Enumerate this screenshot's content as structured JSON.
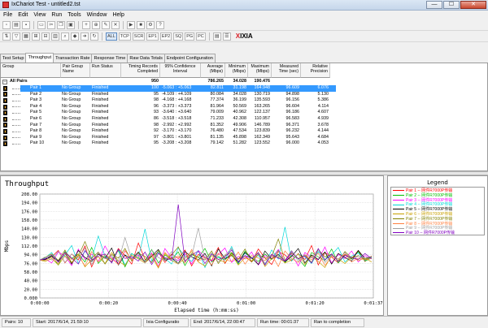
{
  "window": {
    "title": "IxChariot Test - untitled2.tst",
    "minimize": "—",
    "maximize": "☐",
    "close": "✕"
  },
  "menu": [
    "File",
    "Edit",
    "View",
    "Run",
    "Tools",
    "Window",
    "Help"
  ],
  "toolbar2_labels": [
    "ALL",
    "TCP",
    "SCR",
    "EP1",
    "EP2",
    "SQ",
    "PG",
    "PC"
  ],
  "brand": {
    "x": "X",
    "rest": "IXIA"
  },
  "tabs": [
    "Test Setup",
    "Throughput",
    "Transaction Rate",
    "Response Time",
    "Raw Data Totals",
    "Endpoint Configuration"
  ],
  "grid": {
    "headers": {
      "group": "Group",
      "pair_group": "Pair Group Name",
      "run_status": "Run Status",
      "records": "Timing Records Completed",
      "confidence": "95% Confidence Interval",
      "average": "Average (Mbps)",
      "minimum": "Minimum (Mbps)",
      "maximum": "Maximum (Mbps)",
      "time": "Measured Time (sec)",
      "precision": "Relative Precision"
    },
    "summary": {
      "label": "All Pairs",
      "records": "950",
      "average": "786.265",
      "minimum": "34.028",
      "maximum": "190.476",
      "toggle": "−"
    },
    "rows": [
      {
        "name": "Pair 1",
        "group": "No Group",
        "status": "Finished",
        "records": "100",
        "confidence": "-5.063 : +5.063",
        "average": "82.811",
        "minimum": "31.198",
        "maximum": "164.948",
        "time": "96.609",
        "precision": "6.076"
      },
      {
        "name": "Pair 2",
        "group": "No Group",
        "status": "Finished",
        "records": "95",
        "confidence": "-4.109 : +4.109",
        "average": "80.084",
        "minimum": "34.028",
        "maximum": "130.719",
        "time": "94.898",
        "precision": "5.130"
      },
      {
        "name": "Pair 3",
        "group": "No Group",
        "status": "Finished",
        "records": "98",
        "confidence": "-4.168 : +4.168",
        "average": "77.374",
        "minimum": "36.199",
        "maximum": "135.593",
        "time": "96.156",
        "precision": "5.386"
      },
      {
        "name": "Pair 4",
        "group": "No Group",
        "status": "Finished",
        "records": "96",
        "confidence": "-3.373 : +3.373",
        "average": "81.964",
        "minimum": "50.569",
        "maximum": "163.265",
        "time": "96.604",
        "precision": "4.114"
      },
      {
        "name": "Pair 5",
        "group": "No Group",
        "status": "Finished",
        "records": "93",
        "confidence": "-3.640 : +3.640",
        "average": "79.009",
        "minimum": "40.962",
        "maximum": "122.137",
        "time": "96.186",
        "precision": "4.607"
      },
      {
        "name": "Pair 6",
        "group": "No Group",
        "status": "Finished",
        "records": "86",
        "confidence": "-3.518 : +3.518",
        "average": "71.233",
        "minimum": "42.308",
        "maximum": "110.957",
        "time": "96.583",
        "precision": "4.939"
      },
      {
        "name": "Pair 7",
        "group": "No Group",
        "status": "Finished",
        "records": "98",
        "confidence": "-2.992 : +2.992",
        "average": "81.352",
        "minimum": "49.906",
        "maximum": "146.789",
        "time": "96.371",
        "precision": "3.678"
      },
      {
        "name": "Pair 8",
        "group": "No Group",
        "status": "Finished",
        "records": "92",
        "confidence": "-3.170 : +3.170",
        "average": "76.480",
        "minimum": "47.534",
        "maximum": "123.839",
        "time": "96.232",
        "precision": "4.144"
      },
      {
        "name": "Pair 9",
        "group": "No Group",
        "status": "Finished",
        "records": "97",
        "confidence": "-3.801 : +3.801",
        "average": "81.135",
        "minimum": "45.898",
        "maximum": "162.349",
        "time": "95.643",
        "precision": "4.684"
      },
      {
        "name": "Pair 10",
        "group": "No Group",
        "status": "Finished",
        "records": "95",
        "confidence": "-3.208 : +3.208",
        "average": "79.142",
        "minimum": "51.282",
        "maximum": "123.552",
        "time": "96.000",
        "precision": "4.053"
      }
    ]
  },
  "legend": {
    "title": "Legend",
    "items": [
      {
        "label": "Pair 1 -- 网件R7000P传输",
        "color": "#ff0000"
      },
      {
        "label": "Pair 2 -- 网件R7000P传输",
        "color": "#00c000"
      },
      {
        "label": "Pair 3 -- 网件R7000P传输",
        "color": "#ff00ff"
      },
      {
        "label": "Pair 4 -- 网件R7000P传输",
        "color": "#00d8d8"
      },
      {
        "label": "Pair 5 -- 网件R7000P传输",
        "color": "#000000"
      },
      {
        "label": "Pair 6 -- 网件R7000P传输",
        "color": "#c8a000"
      },
      {
        "label": "Pair 7 -- 网件R7000P传输",
        "color": "#808000"
      },
      {
        "label": "Pair 8 -- 网件R7000P传输",
        "color": "#ff8040"
      },
      {
        "label": "Pair 9 -- 网件R7000P传输",
        "color": "#a0a0a0"
      },
      {
        "label": "Pair 10 -- 网件R7000P传输",
        "color": "#8000c0"
      }
    ]
  },
  "chart_data": {
    "type": "line",
    "title": "Throughput",
    "xlabel": "Elapsed time (h:mm:ss)",
    "ylabel": "Mbps",
    "ylim": [
      0,
      208
    ],
    "yticks": [
      "208.00",
      "194.00",
      "176.00",
      "158.00",
      "140.00",
      "130.00",
      "112.00",
      "94.00",
      "76.00",
      "58.00",
      "40.00",
      "20.00",
      "0.000"
    ],
    "xticks": [
      "0:00:00",
      "0:00:20",
      "0:00:40",
      "0:01:00",
      "0:01:20",
      "0:01:37"
    ],
    "xlim_sec": [
      0,
      97
    ],
    "grid": true,
    "series": [
      {
        "name": "Pair 1 -- 网件R7000P传输",
        "color": "#ff0000",
        "values": [
          78,
          82,
          95,
          70,
          88,
          76,
          104,
          62,
          91,
          80,
          73,
          99,
          85,
          68,
          110,
          77,
          83,
          92,
          71,
          88,
          79,
          96,
          64,
          87,
          81,
          75,
          101,
          69,
          90,
          78,
          84,
          72,
          98,
          80,
          67,
          93,
          86,
          74,
          89,
          77,
          105,
          66,
          91,
          82,
          70,
          88,
          79,
          95,
          73,
          84
        ]
      },
      {
        "name": "Pair 2 -- 网件R7000P传输",
        "color": "#00c000",
        "values": [
          76,
          85,
          66,
          93,
          79,
          88,
          72,
          101,
          69,
          84,
          77,
          95,
          62,
          89,
          80,
          74,
          97,
          70,
          86,
          78,
          92,
          65,
          87,
          81,
          99,
          72,
          83,
          76,
          90,
          68,
          94,
          80,
          73,
          88,
          77,
          96,
          71,
          85,
          79,
          63,
          91,
          82,
          75,
          98,
          70,
          86,
          78,
          93,
          74,
          80
        ]
      },
      {
        "name": "Pair 3 -- 网件R7000P传输",
        "color": "#ff00ff",
        "values": [
          79,
          70,
          92,
          84,
          65,
          98,
          77,
          88,
          73,
          104,
          81,
          69,
          94,
          78,
          86,
          72,
          90,
          63,
          99,
          80,
          75,
          89,
          68,
          95,
          82,
          74,
          87,
          100,
          71,
          83,
          78,
          92,
          66,
          85,
          79,
          97,
          73,
          88,
          64,
          91,
          81,
          76,
          102,
          70,
          87,
          79,
          94,
          72,
          85,
          78
        ]
      },
      {
        "name": "Pair 4 -- 网件R7000P传输",
        "color": "#00d8d8",
        "values": [
          80,
          91,
          72,
          86,
          105,
          69,
          94,
          78,
          124,
          83,
          71,
          97,
          66,
          89,
          80,
          138,
          74,
          92,
          79,
          68,
          100,
          84,
          73,
          95,
          61,
          88,
          81,
          76,
          103,
          70,
          90,
          79,
          85,
          67,
          96,
          78,
          142,
          74,
          88,
          82,
          69,
          93,
          77,
          86,
          101,
          72,
          84,
          90,
          75,
          81
        ]
      },
      {
        "name": "Pair 5 -- 网件R7000P传输",
        "color": "#000000",
        "values": [
          77,
          83,
          74,
          90,
          68,
          95,
          81,
          73,
          88,
          79,
          100,
          66,
          86,
          78,
          92,
          71,
          84,
          97,
          75,
          80,
          69,
          93,
          82,
          76,
          89,
          64,
          98,
          79,
          85,
          72,
          91,
          80,
          67,
          94,
          78,
          87,
          73,
          83,
          99,
          70,
          86,
          77,
          92,
          68,
          89,
          81,
          74,
          95,
          79,
          83
        ]
      },
      {
        "name": "Pair 6 -- 网件R7000P传输",
        "color": "#c8a000",
        "values": [
          73,
          79,
          66,
          84,
          71,
          88,
          62,
          77,
          82,
          69,
          91,
          74,
          65,
          86,
          78,
          70,
          83,
          60,
          89,
          75,
          68,
          80,
          93,
          72,
          64,
          85,
          77,
          71,
          87,
          66,
          81,
          74,
          90,
          63,
          79,
          83,
          70,
          76,
          88,
          67,
          84,
          73,
          61,
          86,
          78,
          69,
          82,
          75,
          80,
          72
        ]
      },
      {
        "name": "Pair 7 -- 网件R7000P传输",
        "color": "#808000",
        "values": [
          81,
          88,
          75,
          96,
          70,
          84,
          113,
          79,
          92,
          68,
          87,
          80,
          99,
          74,
          90,
          83,
          71,
          95,
          78,
          86,
          102,
          73,
          89,
          81,
          76,
          94,
          69,
          85,
          91,
          77,
          98,
          72,
          87,
          80,
          83,
          118,
          75,
          90,
          79,
          86,
          71,
          97,
          82,
          88,
          74,
          93,
          80,
          85,
          77,
          82
        ]
      },
      {
        "name": "Pair 8 -- 网件R7000P传输",
        "color": "#ff8040",
        "values": [
          75,
          82,
          69,
          90,
          77,
          85,
          64,
          93,
          72,
          87,
          79,
          67,
          95,
          76,
          83,
          71,
          88,
          62,
          91,
          78,
          84,
          70,
          97,
          74,
          81,
          66,
          89,
          77,
          73,
          92,
          68,
          85,
          80,
          75,
          87,
          63,
          94,
          79,
          71,
          86,
          76,
          90,
          65,
          83,
          78,
          88,
          72,
          80,
          76,
          79
        ]
      },
      {
        "name": "Pair 9 -- 网件R7000P传输",
        "color": "#a0a0a0",
        "values": [
          82,
          76,
          94,
          71,
          88,
          80,
          100,
          67,
          91,
          79,
          85,
          73,
          121,
          78,
          89,
          70,
          96,
          81,
          75,
          93,
          68,
          87,
          83,
          140,
          77,
          90,
          72,
          86,
          99,
          74,
          84,
          79,
          92,
          69,
          88,
          81,
          76,
          95,
          73,
          87,
          80,
          98,
          71,
          85,
          78,
          91,
          75,
          84,
          80,
          83
        ]
      },
      {
        "name": "Pair 10 -- 网件R7000P传输",
        "color": "#8000c0",
        "values": [
          78,
          86,
          72,
          91,
          80,
          68,
          95,
          76,
          84,
          88,
          70,
          97,
          79,
          83,
          74,
          92,
          67,
          89,
          81,
          75,
          187,
          73,
          86,
          94,
          69,
          88,
          77,
          82,
          96,
          71,
          85,
          79,
          90,
          66,
          87,
          80,
          74,
          93,
          78,
          84,
          70,
          99,
          76,
          88,
          73,
          85,
          81,
          77,
          89,
          79
        ]
      }
    ]
  },
  "status": {
    "pairs": "Pairs: 10",
    "start": "Start: 2017/6/14, 21:59:10",
    "config": "Ixia Configuratio",
    "end": "End: 2017/6/14, 22:00:47",
    "runtime": "Run time: 00:01:37",
    "completion": "Ran to completion"
  }
}
